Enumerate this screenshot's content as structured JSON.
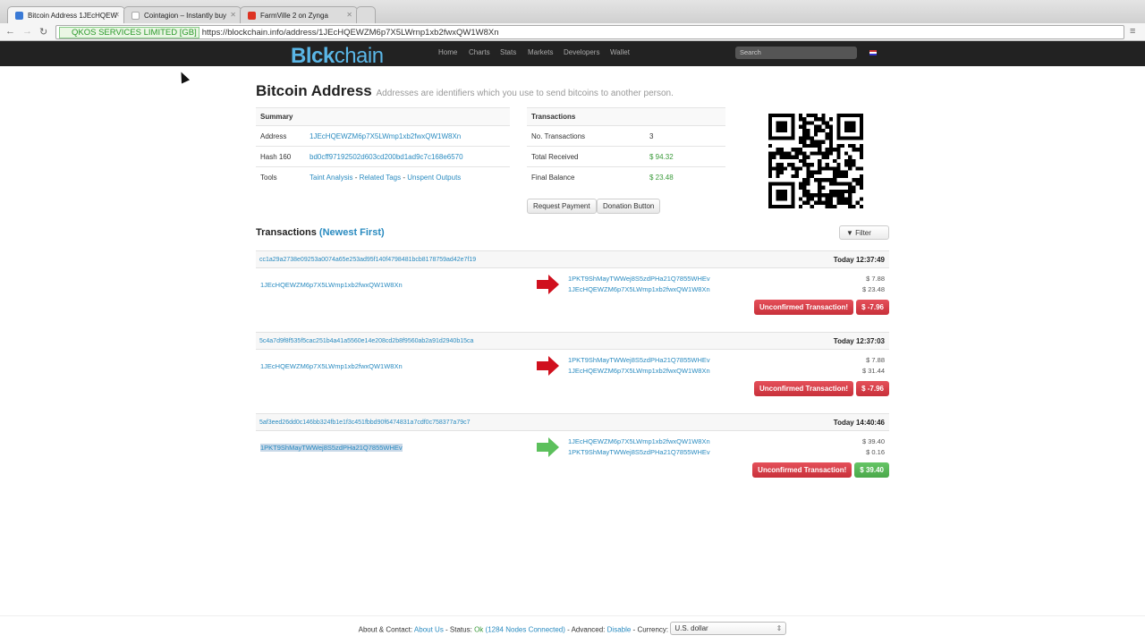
{
  "browser": {
    "tabs": [
      {
        "title": "Bitcoin Address 1JEcHQEW",
        "color": "#3a7ad6"
      },
      {
        "title": "Cointagion – Instantly buy",
        "color": "#fff"
      },
      {
        "title": "FarmVille 2 on Zynga",
        "color": "#d32"
      }
    ],
    "ev_label": "QKOS SERVICES LIMITED [GB]",
    "url": "https://blockchain.info/address/1JEcHQEWZM6p7X5LWrnp1xb2fwxQW1W8Xn"
  },
  "nav": {
    "logo_a": "Bl",
    "logo_b": "ck",
    "logo_c": "chain",
    "items": [
      "Home",
      "Charts",
      "Stats",
      "Markets",
      "Developers",
      "Wallet"
    ],
    "search_placeholder": "Search"
  },
  "page": {
    "title": "Bitcoin Address",
    "subtitle": "Addresses are identifiers which you use to send bitcoins to another person."
  },
  "summary": {
    "header": "Summary",
    "address_label": "Address",
    "address": "1JEcHQEWZM6p7X5LWmp1xb2fwxQW1W8Xn",
    "hash_label": "Hash 160",
    "hash": "bd0cff97192502d603cd200bd1ad9c7c168e6570",
    "tools_label": "Tools",
    "tools": [
      "Taint Analysis",
      "Related Tags",
      "Unspent Outputs"
    ],
    "sep": " - "
  },
  "stats": {
    "header": "Transactions",
    "n_label": "No. Transactions",
    "n": "3",
    "recv_label": "Total Received",
    "recv": "$ 94.32",
    "bal_label": "Final Balance",
    "bal": "$ 23.48"
  },
  "buttons": {
    "request": "Request Payment",
    "donation": "Donation Button",
    "filter": "▼ Filter"
  },
  "tx_section": {
    "title": "Transactions",
    "order": "(Newest First)"
  },
  "transactions": [
    {
      "hash": "cc1a29a2738e09253a0074a65e253ad95f140f4798481bcb8178759ad42e7f19",
      "time": "Today 12:37:49",
      "from": "1JEcHQEWZM6p7X5LWmp1xb2fwxQW1W8Xn",
      "dir": "out",
      "outs": [
        "1PKT9ShMayTWWej8S5zdPHa21Q7855WHEv",
        "1JEcHQEWZM6p7X5LWmp1xb2fwxQW1W8Xn"
      ],
      "amts": [
        "$ 7.88",
        "$ 23.48"
      ],
      "status": "Unconfirmed Transaction!",
      "net": "$ -7.96"
    },
    {
      "hash": "5c4a7d9f8f535f5cac251b4a41a5560e14e208cd2b8f9560ab2a91d2940b15ca",
      "time": "Today 12:37:03",
      "from": "1JEcHQEWZM6p7X5LWmp1xb2fwxQW1W8Xn",
      "dir": "out",
      "outs": [
        "1PKT9ShMayTWWej8S5zdPHa21Q7855WHEv",
        "1JEcHQEWZM6p7X5LWmp1xb2fwxQW1W8Xn"
      ],
      "amts": [
        "$ 7.88",
        "$ 31.44"
      ],
      "status": "Unconfirmed Transaction!",
      "net": "$ -7.96"
    },
    {
      "hash": "5af3eed26dd0c146bb324fb1e1f3c451fbbd90f6474831a7cdf0c758377a79c7",
      "time": "Today 14:40:46",
      "from": "1PKT9ShMayTWWej8S5zdPHa21Q7855WHEv",
      "dir": "in",
      "outs": [
        "1JEcHQEWZM6p7X5LWmp1xb2fwxQW1W8Xn",
        "1PKT9ShMayTWWej8S5zdPHa21Q7855WHEv"
      ],
      "amts": [
        "$ 39.40",
        "$ 0.16"
      ],
      "status": "Unconfirmed Transaction!",
      "net": "$ 39.40"
    }
  ],
  "footer": {
    "about_label": "About & Contact:",
    "about": "About Us",
    "status_label": " - Status:",
    "status": "Ok",
    "nodes": "(1284 Nodes Connected)",
    "adv_label": " - Advanced:",
    "adv": "Disable",
    "cur_label": " - Currency:",
    "currency": "U.S. dollar"
  }
}
